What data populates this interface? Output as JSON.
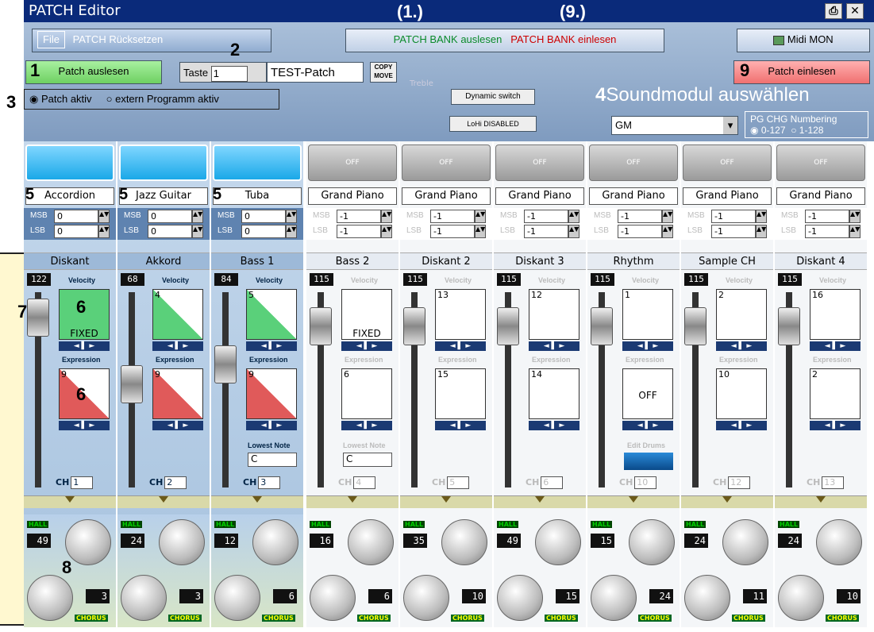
{
  "title": "PATCH Editor",
  "callouts": {
    "c1": "(1.)",
    "c9": "(9.)",
    "n1": "1",
    "n2": "2",
    "n3": "3",
    "n4": "4",
    "n5a": "5",
    "n5b": "5",
    "n5c": "5",
    "n6a": "6",
    "n6b": "6",
    "n7": "7",
    "n8": "8",
    "n9": "9"
  },
  "menu": {
    "file": "File",
    "reset": "PATCH Rücksetzen"
  },
  "bank": {
    "read": "PATCH BANK auslesen",
    "write": "PATCH BANK einlesen"
  },
  "midi_mon": "Midi MON",
  "patch_read": "Patch auslesen",
  "patch_write": "Patch einlesen",
  "taste_label": "Taste",
  "taste_value": "1",
  "patch_name": "TEST-Patch",
  "copy_move": "COPY MOVE",
  "radio_patch": "Patch aktiv",
  "radio_extern": "extern Programm aktiv",
  "treble": "Treble",
  "dynamic_switch": "Dynamic switch",
  "lohi": "LoHi DISABLED",
  "soundmodul_label": "Soundmodul auswählen",
  "soundmodul_value": "GM",
  "pg_chg_title": "PG CHG Numbering",
  "pg_opt1": "0-127",
  "pg_opt2": "1-128",
  "velocity_label": "Velocity",
  "expression_label": "Expression",
  "lowest_note_label": "Lowest Note",
  "edit_drums_label": "Edit Drums",
  "off_label": "OFF",
  "fixed_label": "FIXED",
  "msb": "MSB",
  "lsb": "LSB",
  "ch": "CH",
  "hall": "HALL",
  "chorus": "CHORUS",
  "channels": [
    {
      "sound": "Accordion",
      "msb": "0",
      "lsb": "0",
      "name": "Diskant",
      "level": "122",
      "vel": "",
      "exp": "9",
      "ch": "1",
      "hall": "49",
      "chorus": "3",
      "active": true
    },
    {
      "sound": "Jazz Guitar",
      "msb": "0",
      "lsb": "0",
      "name": "Akkord",
      "level": "68",
      "vel": "4",
      "exp": "9",
      "ch": "2",
      "hall": "24",
      "chorus": "3",
      "active": true
    },
    {
      "sound": "Tuba",
      "msb": "0",
      "lsb": "0",
      "name": "Bass 1",
      "level": "84",
      "vel": "5",
      "exp": "9",
      "ch": "3",
      "hall": "12",
      "chorus": "6",
      "active": true,
      "lowest": "C"
    },
    {
      "sound": "Grand Piano",
      "msb": "-1",
      "lsb": "-1",
      "name": "Bass 2",
      "level": "115",
      "vel": "",
      "exp": "6",
      "ch": "4",
      "hall": "16",
      "chorus": "6",
      "active": false,
      "lowest": "C"
    },
    {
      "sound": "Grand Piano",
      "msb": "-1",
      "lsb": "-1",
      "name": "Diskant 2",
      "level": "115",
      "vel": "13",
      "exp": "15",
      "ch": "5",
      "hall": "35",
      "chorus": "10",
      "active": false
    },
    {
      "sound": "Grand Piano",
      "msb": "-1",
      "lsb": "-1",
      "name": "Diskant 3",
      "level": "115",
      "vel": "12",
      "exp": "14",
      "ch": "6",
      "hall": "49",
      "chorus": "15",
      "active": false
    },
    {
      "sound": "Grand Piano",
      "msb": "-1",
      "lsb": "-1",
      "name": "Rhythm",
      "level": "115",
      "vel": "1",
      "exp": "",
      "ch": "10",
      "hall": "15",
      "chorus": "24",
      "active": false
    },
    {
      "sound": "Grand Piano",
      "msb": "-1",
      "lsb": "-1",
      "name": "Sample CH",
      "level": "115",
      "vel": "2",
      "exp": "10",
      "ch": "12",
      "hall": "24",
      "chorus": "11",
      "active": false
    },
    {
      "sound": "Grand Piano",
      "msb": "-1",
      "lsb": "-1",
      "name": "Diskant 4",
      "level": "115",
      "vel": "16",
      "exp": "2",
      "ch": "13",
      "hall": "24",
      "chorus": "10",
      "active": false
    }
  ]
}
